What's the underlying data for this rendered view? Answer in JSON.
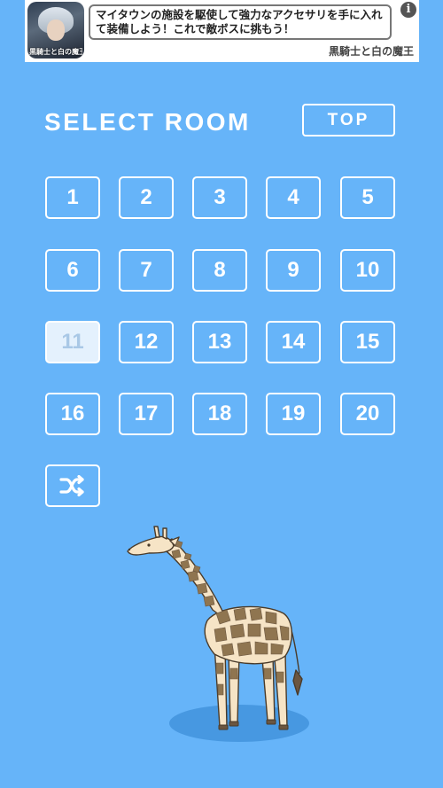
{
  "ad": {
    "thumb_label": "黒騎士と白の魔王",
    "text": "マイタウンの施設を駆使して強力なアクセサリを手に入れて装備しよう！これで敵ボスに挑もう！",
    "app_name": "黒騎士と白の魔王",
    "info_label": "i"
  },
  "header": {
    "title": "SELECT ROOM",
    "top_label": "TOP"
  },
  "rooms": [
    "1",
    "2",
    "3",
    "4",
    "5",
    "6",
    "7",
    "8",
    "9",
    "10",
    "11",
    "12",
    "13",
    "14",
    "15",
    "16",
    "17",
    "18",
    "19",
    "20"
  ],
  "selected_room": "11",
  "shuffle": {
    "icon": "shuffle-icon"
  },
  "colors": {
    "background": "#66b4f9",
    "selected_fill": "#e4f1fd",
    "selected_text": "#a9c8e6",
    "shadow": "#3d8fd8"
  }
}
